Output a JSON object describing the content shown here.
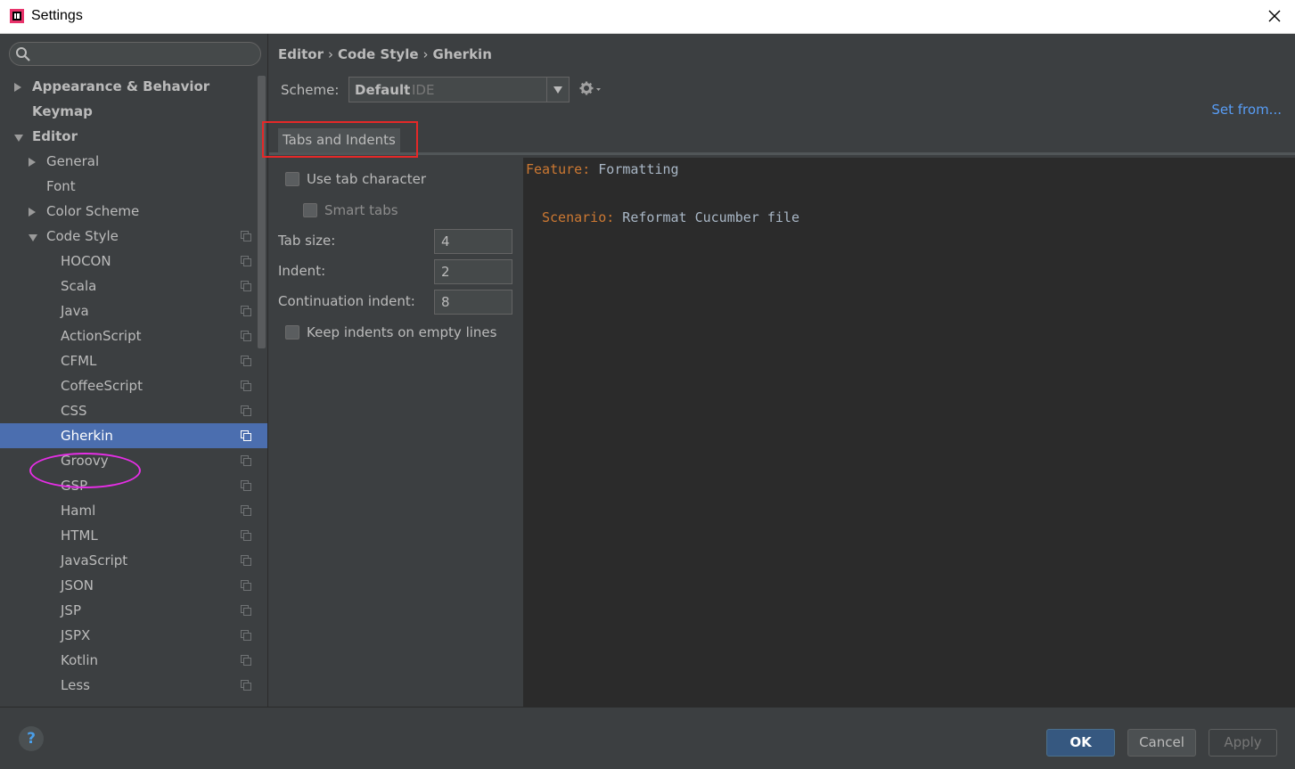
{
  "window": {
    "title": "Settings"
  },
  "search": {
    "placeholder": ""
  },
  "tree": {
    "items": [
      {
        "label": "Appearance & Behavior",
        "level": 0,
        "arrow": "right",
        "bold": true
      },
      {
        "label": "Keymap",
        "level": 0,
        "arrow": "none",
        "bold": true
      },
      {
        "label": "Editor",
        "level": 0,
        "arrow": "down",
        "bold": true
      },
      {
        "label": "General",
        "level": 1,
        "arrow": "right"
      },
      {
        "label": "Font",
        "level": 1,
        "arrow": "none"
      },
      {
        "label": "Color Scheme",
        "level": 1,
        "arrow": "right"
      },
      {
        "label": "Code Style",
        "level": 1,
        "arrow": "down",
        "copy": true
      },
      {
        "label": "HOCON",
        "level": 2,
        "copy": true
      },
      {
        "label": "Scala",
        "level": 2,
        "copy": true
      },
      {
        "label": "Java",
        "level": 2,
        "copy": true
      },
      {
        "label": "ActionScript",
        "level": 2,
        "copy": true
      },
      {
        "label": "CFML",
        "level": 2,
        "copy": true
      },
      {
        "label": "CoffeeScript",
        "level": 2,
        "copy": true
      },
      {
        "label": "CSS",
        "level": 2,
        "copy": true
      },
      {
        "label": "Gherkin",
        "level": 2,
        "copy": true,
        "selected": true
      },
      {
        "label": "Groovy",
        "level": 2,
        "copy": true
      },
      {
        "label": "GSP",
        "level": 2,
        "copy": true
      },
      {
        "label": "Haml",
        "level": 2,
        "copy": true
      },
      {
        "label": "HTML",
        "level": 2,
        "copy": true
      },
      {
        "label": "JavaScript",
        "level": 2,
        "copy": true
      },
      {
        "label": "JSON",
        "level": 2,
        "copy": true
      },
      {
        "label": "JSP",
        "level": 2,
        "copy": true
      },
      {
        "label": "JSPX",
        "level": 2,
        "copy": true
      },
      {
        "label": "Kotlin",
        "level": 2,
        "copy": true
      },
      {
        "label": "Less",
        "level": 2,
        "copy": true
      }
    ]
  },
  "breadcrumb": {
    "part1": "Editor",
    "part2": "Code Style",
    "part3": "Gherkin",
    "separator": "›"
  },
  "scheme": {
    "label": "Scheme:",
    "value": "Default",
    "sub": "IDE"
  },
  "set_from": "Set from...",
  "tabs": [
    {
      "label": "Tabs and Indents"
    }
  ],
  "options": {
    "use_tab": "Use tab character",
    "smart_tabs": "Smart tabs",
    "tab_size_label": "Tab size:",
    "tab_size": "4",
    "indent_label": "Indent:",
    "indent": "2",
    "cont_indent_label": "Continuation indent:",
    "cont_indent": "8",
    "keep_indents": "Keep indents on empty lines"
  },
  "preview": {
    "line1_kw": "Feature:",
    "line1_text": " Formatting",
    "line2_kw": "Scenario:",
    "line2_text": " Reformat Cucumber file"
  },
  "footer": {
    "help": "?",
    "ok": "OK",
    "cancel": "Cancel",
    "apply": "Apply"
  },
  "colors": {
    "selection": "#4b6eaf",
    "keyword": "#cc7832",
    "link": "#589df6",
    "annotation_red": "#e52828",
    "annotation_magenta": "#e62ee6"
  }
}
